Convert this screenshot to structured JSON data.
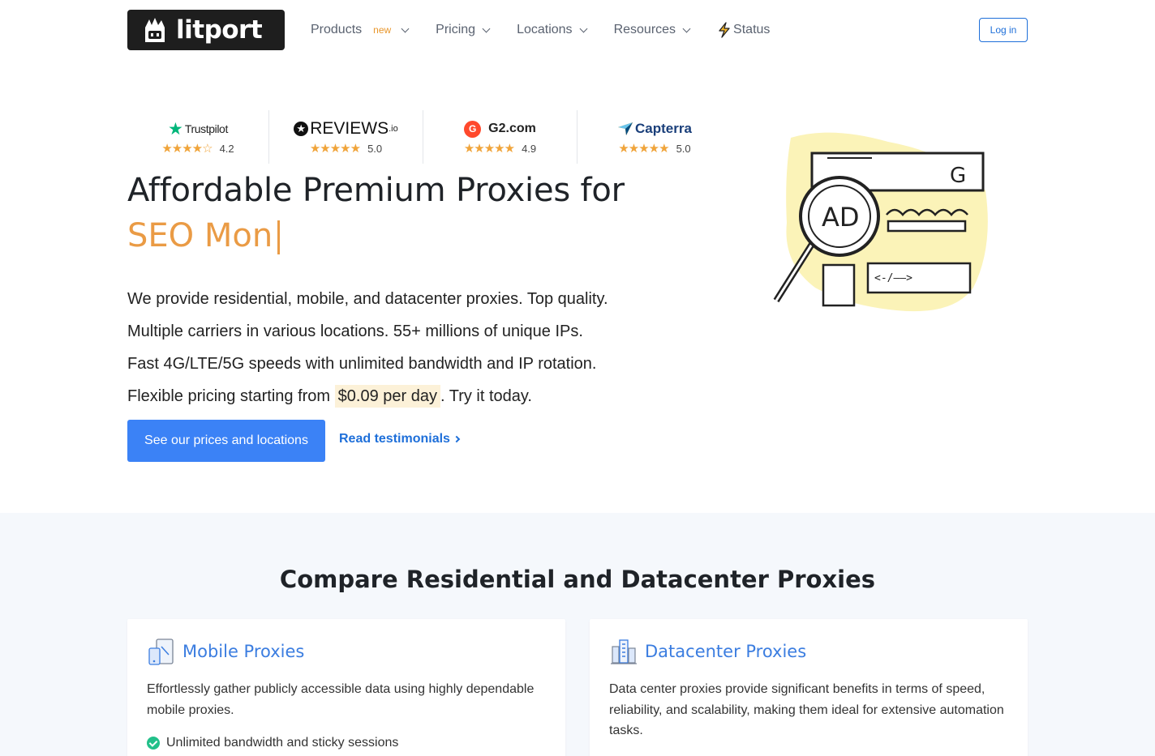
{
  "header": {
    "logo_text": "litport",
    "nav": {
      "products": "Products",
      "products_badge": "new",
      "pricing": "Pricing",
      "locations": "Locations",
      "resources": "Resources",
      "status": "Status"
    },
    "login": "Log in"
  },
  "ratings": [
    {
      "brand": "Trustpilot",
      "score": "4.2",
      "stars": "★★★★☆"
    },
    {
      "brand": "REVIEWS",
      "brand_suffix": ".io",
      "score": "5.0",
      "stars": "★★★★★"
    },
    {
      "brand": "G2.com",
      "score": "4.9",
      "stars": "★★★★★"
    },
    {
      "brand": "Capterra",
      "score": "5.0",
      "stars": "★★★★★"
    }
  ],
  "hero": {
    "title": "Affordable Premium Proxies for",
    "typed_text": "SEO Mon",
    "lines": [
      "We provide residential, mobile, and datacenter proxies. Top quality.",
      "Multiple carriers in various locations. 55+ millions of unique IPs.",
      "Fast 4G/LTE/5G speeds with unlimited bandwidth and IP rotation."
    ],
    "pricing_prefix": "Flexible pricing starting from",
    "pricing_highlight": "$0.09 per day",
    "pricing_suffix": ". Try it today.",
    "cta": "See our prices and locations",
    "testimonials_link": "Read testimonials"
  },
  "illustration": {
    "badge_g": "G",
    "lens_text": "AD"
  },
  "compare": {
    "title": "Compare Residential and Datacenter Proxies",
    "cards": [
      {
        "title": "Mobile Proxies",
        "description": "Effortlessly gather publicly accessible data using highly dependable mobile proxies.",
        "feature": "Unlimited bandwidth and sticky sessions"
      },
      {
        "title": "Datacenter Proxies",
        "description": "Data center proxies provide significant benefits in terms of speed, reliability, and scalability, making them ideal for extensive automation tasks."
      }
    ]
  },
  "colors": {
    "accent_orange": "#ea9b45",
    "primary_blue": "#3b82f6",
    "link_blue": "#1e6fd9",
    "star_gold": "#f0a43a"
  }
}
